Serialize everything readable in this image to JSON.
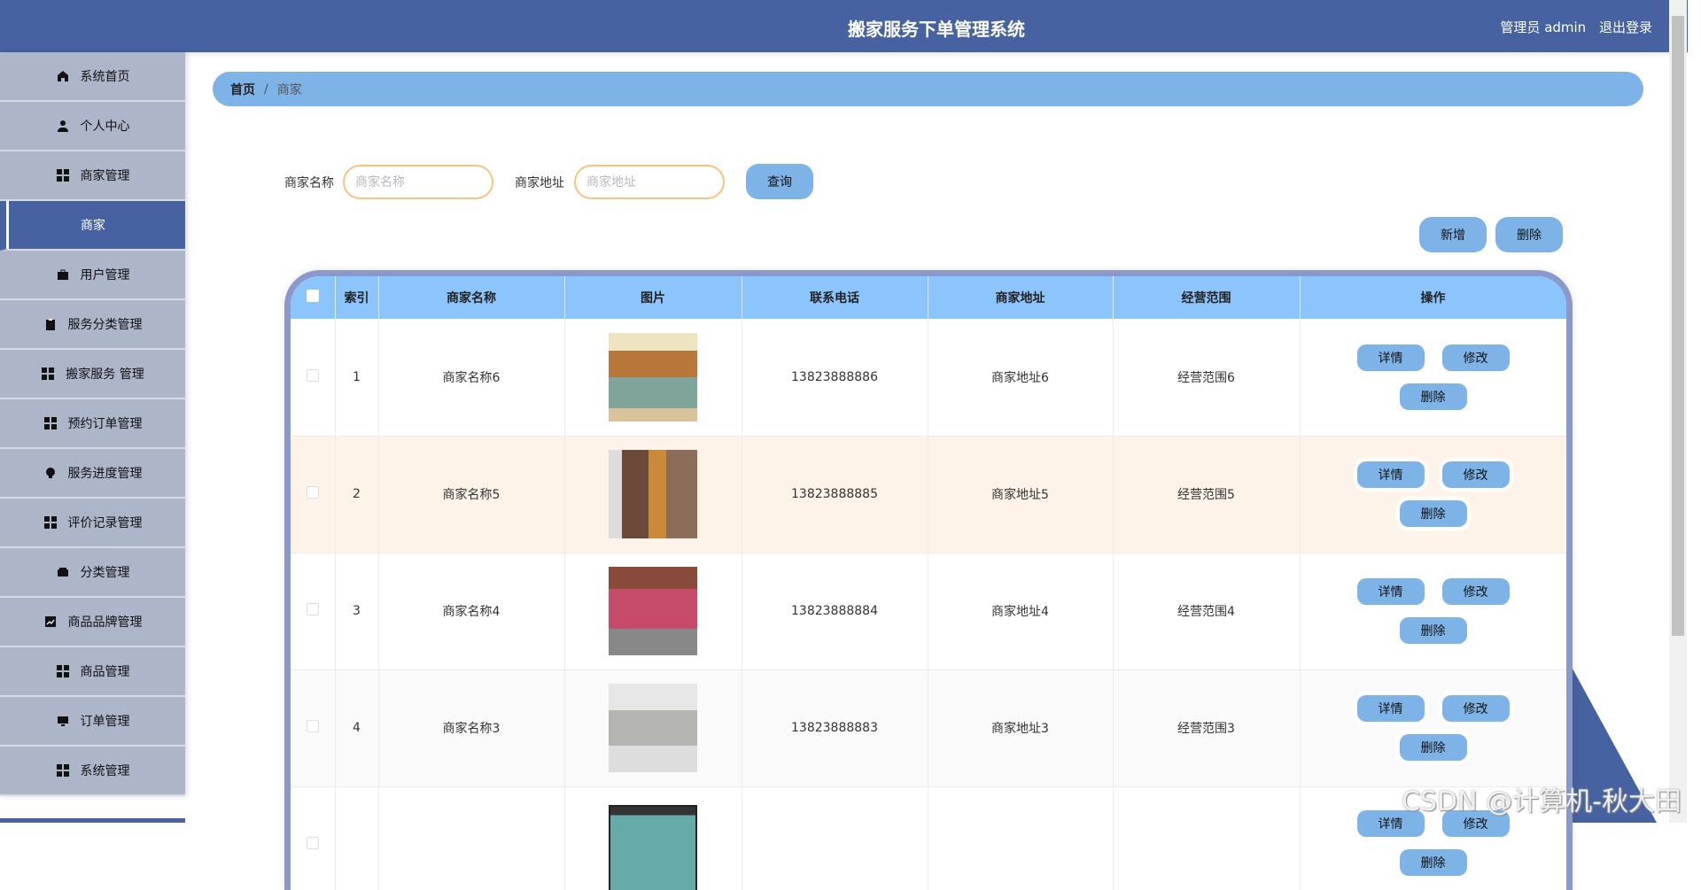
{
  "header": {
    "title": "搬家服务下单管理系统",
    "user": "管理员 admin",
    "logout": "退出登录"
  },
  "sidebar": {
    "items": [
      {
        "label": "系统首页",
        "icon": "home-icon"
      },
      {
        "label": "个人中心",
        "icon": "user-icon"
      },
      {
        "label": "商家管理",
        "icon": "grid-icon"
      },
      {
        "label": "商家",
        "icon": "",
        "active": true
      },
      {
        "label": "用户管理",
        "icon": "briefcase-icon"
      },
      {
        "label": "服务分类管理",
        "icon": "clipboard-icon"
      },
      {
        "label": "搬家服务 管理",
        "icon": "grid-icon"
      },
      {
        "label": "预约订单管理",
        "icon": "grid-icon"
      },
      {
        "label": "服务进度管理",
        "icon": "bulb-icon"
      },
      {
        "label": "评价记录管理",
        "icon": "grid-icon"
      },
      {
        "label": "分类管理",
        "icon": "wallet-icon"
      },
      {
        "label": "商品品牌管理",
        "icon": "chart-icon"
      },
      {
        "label": "商品管理",
        "icon": "grid-icon"
      },
      {
        "label": "订单管理",
        "icon": "monitor-icon"
      },
      {
        "label": "系统管理",
        "icon": "grid-icon"
      }
    ]
  },
  "breadcrumb": {
    "home": "首页",
    "separator": "/",
    "current": "商家"
  },
  "search": {
    "name_label": "商家名称",
    "name_placeholder": "商家名称",
    "name_value": "",
    "address_label": "商家地址",
    "address_placeholder": "商家地址",
    "address_value": "",
    "query_button": "查询"
  },
  "actions": {
    "add": "新增",
    "delete": "删除"
  },
  "table": {
    "headers": [
      "索引",
      "商家名称",
      "图片",
      "联系电话",
      "商家地址",
      "经营范围",
      "操作"
    ],
    "row_buttons": {
      "detail": "详情",
      "edit": "修改",
      "delete": "删除"
    },
    "rows": [
      {
        "index": "1",
        "name": "商家名称6",
        "phone": "13823888886",
        "address": "商家地址6",
        "scope": "经营范围6"
      },
      {
        "index": "2",
        "name": "商家名称5",
        "phone": "13823888885",
        "address": "商家地址5",
        "scope": "经营范围5"
      },
      {
        "index": "3",
        "name": "商家名称4",
        "phone": "13823888884",
        "address": "商家地址4",
        "scope": "经营范围4"
      },
      {
        "index": "4",
        "name": "商家名称3",
        "phone": "13823888883",
        "address": "商家地址3",
        "scope": "经营范围3"
      }
    ]
  },
  "colors": {
    "header": "#4662a0",
    "sidebar": "#adb5c9",
    "accent": "#7eb3e8",
    "table_head": "#8cc4fc",
    "hover_row": "#fdf3e8"
  },
  "watermark": "CSDN @计算机-秋大田"
}
